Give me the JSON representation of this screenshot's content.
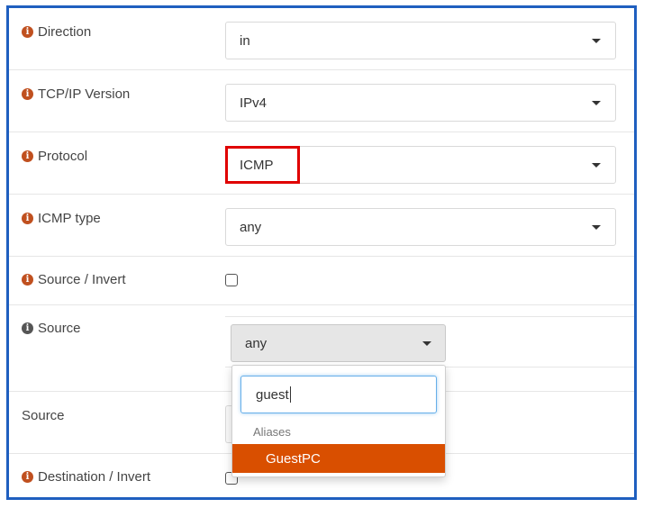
{
  "form": {
    "direction": {
      "label": "Direction",
      "value": "in"
    },
    "tcpip": {
      "label": "TCP/IP Version",
      "value": "IPv4"
    },
    "protocol": {
      "label": "Protocol",
      "value": "ICMP"
    },
    "icmp_type": {
      "label": "ICMP type",
      "value": "any"
    },
    "source_invert": {
      "label": "Source / Invert",
      "checked": false
    },
    "source": {
      "label": "Source",
      "value": "any"
    },
    "source_secondary": {
      "label": "Source"
    },
    "destination_invert": {
      "label": "Destination / Invert",
      "checked": false
    }
  },
  "source_dropdown": {
    "search_value": "guest",
    "group_header": "Aliases",
    "options": [
      "GuestPC"
    ]
  },
  "colors": {
    "frame_border": "#1f5fbf",
    "highlight_border": "#e00000",
    "info_icon": "#c0501f",
    "selected_option_bg": "#d94f00"
  }
}
